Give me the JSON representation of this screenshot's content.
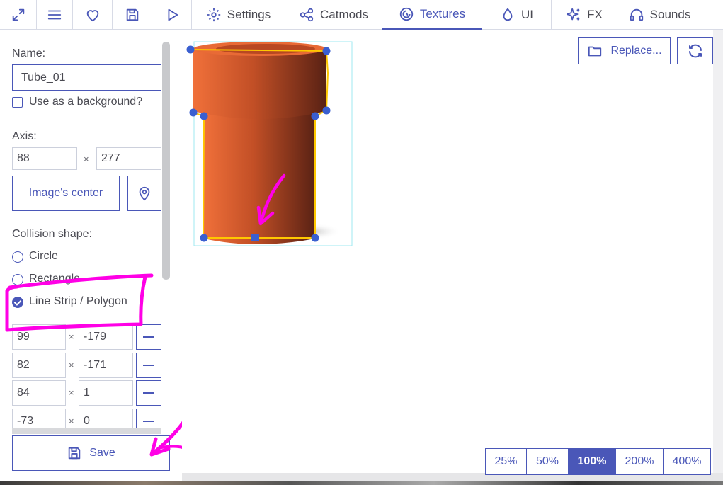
{
  "toolbar": {
    "tabs": [
      {
        "label": "Settings",
        "icon": "gear-icon"
      },
      {
        "label": "Catmods",
        "icon": "share-nodes-icon"
      },
      {
        "label": "Textures",
        "icon": "texture-icon"
      },
      {
        "label": "UI",
        "icon": "droplet-icon"
      },
      {
        "label": "FX",
        "icon": "sparkles-icon"
      },
      {
        "label": "Sounds",
        "icon": "headphones-icon"
      }
    ],
    "active_tab": "Textures"
  },
  "panel": {
    "name_label": "Name:",
    "name_value": "Tube_01",
    "background_checkbox_label": "Use as a background?",
    "axis_label": "Axis:",
    "axis_x": "88",
    "axis_y": "277",
    "times": "×",
    "center_button": "Image's center",
    "collision_label": "Collision shape:",
    "shapes": [
      "Circle",
      "Rectangle",
      "Line Strip / Polygon"
    ],
    "selected_shape": "Line Strip / Polygon",
    "points": [
      {
        "x": "99",
        "y": "-179"
      },
      {
        "x": "82",
        "y": "-171"
      },
      {
        "x": "84",
        "y": "1"
      },
      {
        "x": "-73",
        "y": "0"
      }
    ],
    "save_label": "Save"
  },
  "canvas": {
    "replace_label": "Replace...",
    "zoom_levels": [
      "25%",
      "50%",
      "100%",
      "200%",
      "400%"
    ],
    "active_zoom": "100%"
  },
  "colors": {
    "accent": "#4a57b8",
    "annotation": "#ff00e6",
    "tube": "#c85a2e",
    "collision_outline": "#ffc800",
    "collision_point": "#3a5fd0"
  }
}
